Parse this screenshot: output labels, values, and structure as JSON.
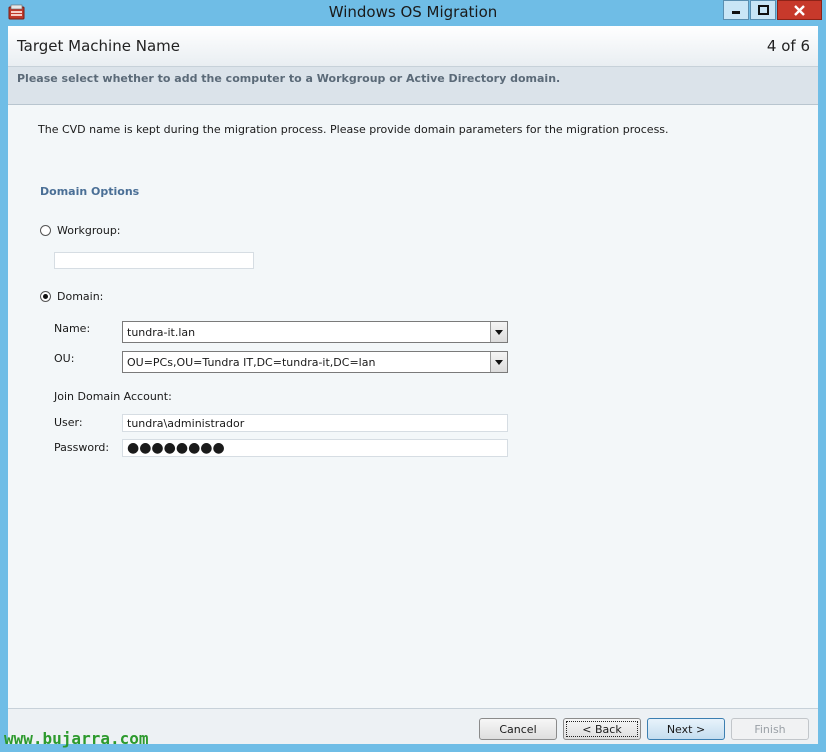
{
  "window": {
    "title": "Windows OS Migration"
  },
  "header": {
    "title": "Target Machine Name",
    "step": "4 of 6"
  },
  "instruction": "Please select whether to add the computer to a Workgroup or Active Directory domain.",
  "content": {
    "description": "The CVD name is kept during the migration process. Please provide domain parameters for the migration process.",
    "section_title": "Domain Options",
    "workgroup": {
      "label": "Workgroup:",
      "selected": false,
      "value": ""
    },
    "domain": {
      "label": "Domain:",
      "selected": true,
      "name_label": "Name:",
      "name_value": "tundra-it.lan",
      "ou_label": "OU:",
      "ou_value": "OU=PCs,OU=Tundra IT,DC=tundra-it,DC=lan",
      "join_account_label": "Join Domain Account:",
      "user_label": "User:",
      "user_value": "tundra\\administrador",
      "password_label": "Password:",
      "password_value": "●●●●●●●●"
    }
  },
  "footer": {
    "cancel": "Cancel",
    "back": "< Back",
    "next": "Next >",
    "finish": "Finish"
  },
  "watermark": "www.bujarra.com",
  "colors": {
    "titlebar": "#6fbde6",
    "section_title": "#4a6f96",
    "close_button": "#c7392b",
    "watermark": "#2d9a2d"
  }
}
